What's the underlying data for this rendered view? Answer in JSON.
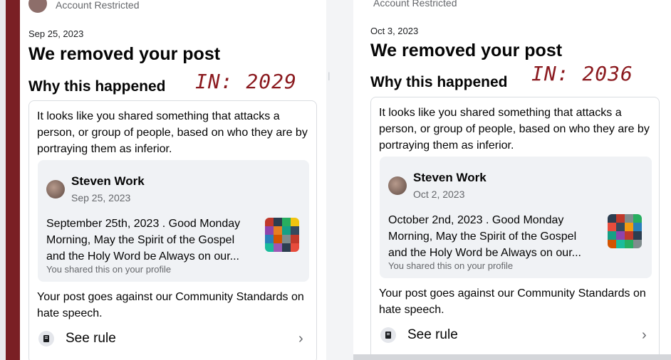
{
  "left": {
    "header_label": "Account Restricted",
    "date": "Sep 25, 2023",
    "title": "We removed your post",
    "subtitle": "Why this happened",
    "annotation": "IN: 2029",
    "intro": "It looks like you shared something that attacks a person, or group of people, based on who they are by portraying them as inferior.",
    "post": {
      "author": "Steven Work",
      "date": "Sep 25, 2023",
      "text": "September 25th, 2023 . Good Monday Morning, May the Spirit of the Gospel and the Holy Word be Always on our...",
      "shared_note": "You shared this on your profile"
    },
    "standards_text": "Your post goes against our Community Standards on hate speech.",
    "see_rule": "See rule",
    "chevron": "›"
  },
  "right": {
    "header_label": "Account Restricted",
    "date": "Oct 3, 2023",
    "title": "We removed your post",
    "subtitle": "Why this happened",
    "annotation": "IN: 2036",
    "intro": "It looks like you shared something that attacks a person, or group of people, based on who they are by portraying them as inferior.",
    "post": {
      "author": "Steven Work",
      "date": "Oct 2, 2023",
      "text": "October 2nd, 2023 . Good Monday Morning, May the Spirit of the Gospel and the Holy Word be Always on our...",
      "shared_note": "You shared this on your profile"
    },
    "standards_text": "Your post goes against our Community Standards on hate speech.",
    "see_rule": "See rule",
    "chevron": "›"
  },
  "icons": {
    "rule": "rule-book-icon",
    "chevron": "chevron-right-icon"
  },
  "colors": {
    "annotation": "#8b1a1f",
    "left_border": "#7a1f24",
    "secondary_text": "#65676b",
    "inner_card": "#f0f2f5"
  }
}
